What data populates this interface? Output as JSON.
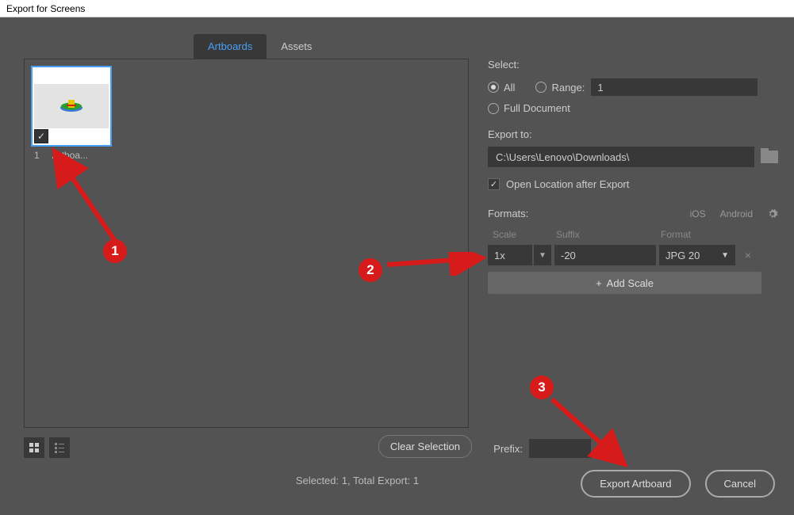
{
  "window_title": "Export for Screens",
  "tabs": {
    "artboards": "Artboards",
    "assets": "Assets"
  },
  "thumb": {
    "index": "1",
    "name": "Artboa...",
    "checked": true
  },
  "select": {
    "label": "Select:",
    "all": "All",
    "range_label": "Range:",
    "range_value": "1",
    "full_document": "Full Document",
    "selected_option": "all"
  },
  "export_to": {
    "label": "Export to:",
    "path": "C:\\Users\\Lenovo\\Downloads\\"
  },
  "open_location": {
    "label": "Open Location after Export",
    "checked": true
  },
  "formats": {
    "label": "Formats:",
    "ios": "iOS",
    "android": "Android",
    "headers": {
      "scale": "Scale",
      "suffix": "Suffix",
      "format": "Format"
    },
    "row": {
      "scale": "1x",
      "suffix": "-20",
      "format": "JPG 20"
    },
    "add_scale": "Add Scale"
  },
  "buttons": {
    "clear_selection": "Clear Selection",
    "export_artboard": "Export Artboard",
    "cancel": "Cancel"
  },
  "prefix": {
    "label": "Prefix:",
    "value": ""
  },
  "status": "Selected: 1, Total Export: 1",
  "annotations": {
    "n1": "1",
    "n2": "2",
    "n3": "3"
  }
}
